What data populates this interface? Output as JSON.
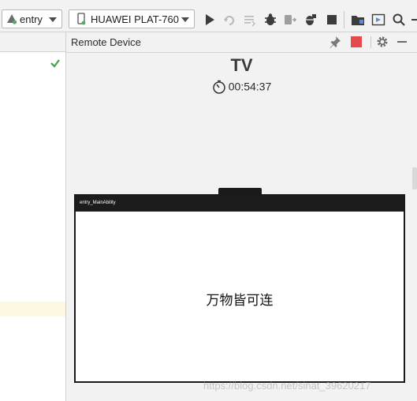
{
  "toolbar": {
    "module_select": "entry",
    "device_select": "HUAWEI PLAT-760"
  },
  "panel": {
    "title": "Remote Device"
  },
  "device": {
    "name": "TV",
    "session_time": "00:54:37"
  },
  "tv_screen": {
    "app_title": "entry_MainAbility",
    "body_text": "万物皆可连"
  },
  "watermark": "https://blog.csdn.net/sinat_39620217",
  "colors": {
    "stop_red": "#e5484d",
    "check_green": "#43a047",
    "run_green": "#59a869",
    "highlight": "#fdf8e1"
  }
}
